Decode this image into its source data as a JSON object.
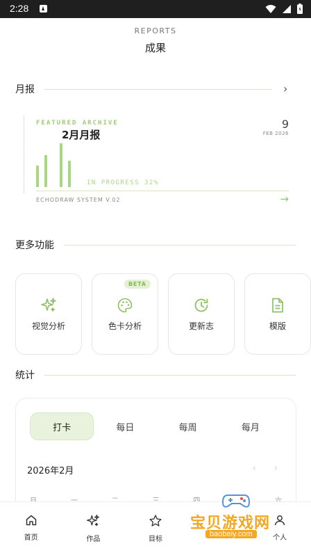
{
  "status_bar": {
    "time": "2:28"
  },
  "header": {
    "eyebrow": "REPORTS",
    "title": "成果"
  },
  "monthly": {
    "section_label": "月报",
    "archive": {
      "eyebrow": "FEATURED ARCHIVE",
      "title": "2月月报",
      "number": "9",
      "date": "FEB 2026",
      "progress_label": "IN PROGRESS 32%",
      "progress_percent": 32,
      "system_label": "ECHODRAW SYSTEM V.02",
      "bar_levels": [
        0.47,
        0.7,
        0.95,
        0.57
      ]
    }
  },
  "more": {
    "section_label": "更多功能",
    "cards": [
      {
        "label": "视觉分析",
        "icon": "sparkles-icon",
        "badge": ""
      },
      {
        "label": "色卡分析",
        "icon": "palette-icon",
        "badge": "BETA"
      },
      {
        "label": "更新志",
        "icon": "history-icon",
        "badge": ""
      },
      {
        "label": "模版",
        "icon": "document-icon",
        "badge": ""
      }
    ]
  },
  "stats": {
    "section_label": "统计",
    "segments": [
      "打卡",
      "每日",
      "每周",
      "每月"
    ],
    "active_segment": 0,
    "month_label": "2026年2月",
    "weekdays": [
      "日",
      "一",
      "二",
      "三",
      "四",
      "五",
      "六"
    ]
  },
  "tabbar": {
    "items": [
      {
        "label": "首页",
        "icon": "home-icon"
      },
      {
        "label": "作品",
        "icon": "sparkles-icon"
      },
      {
        "label": "目标",
        "icon": "star-icon"
      },
      {
        "label": "",
        "icon": ""
      },
      {
        "label": "个人",
        "icon": "user-icon"
      }
    ]
  },
  "watermark": {
    "text_cn": "宝贝游戏网",
    "text_en": "baobeiy.com"
  },
  "colors": {
    "accent": "#a8d784",
    "accent_soft": "#e8f2dc",
    "line": "#d9e8c4",
    "icon_green": "#8cc063"
  }
}
